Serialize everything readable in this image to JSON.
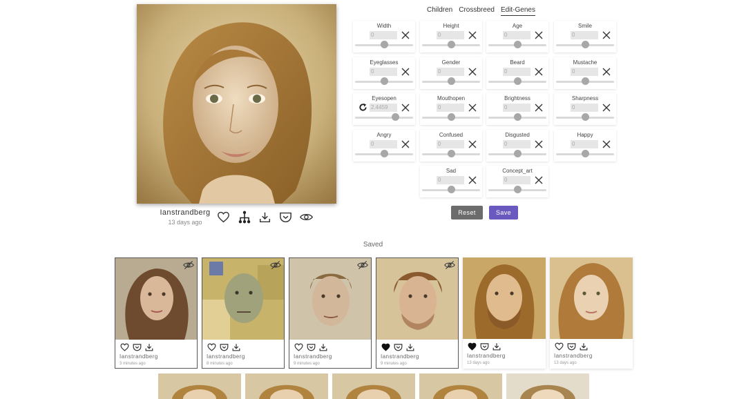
{
  "main": {
    "owner": "Ianstrandberg",
    "time": "13 days ago"
  },
  "tabs": [
    {
      "label": "Children",
      "active": false
    },
    {
      "label": "Crossbreed",
      "active": false
    },
    {
      "label": "Edit-Genes",
      "active": true
    }
  ],
  "genes": [
    {
      "label": "Width",
      "value": "0",
      "level": 0.5
    },
    {
      "label": "Height",
      "value": "0",
      "level": 0.5
    },
    {
      "label": "Age",
      "value": "0",
      "level": 0.5
    },
    {
      "label": "Smile",
      "value": "0",
      "level": 0.5
    },
    {
      "label": "Eyeglasses",
      "value": "0",
      "level": 0.5
    },
    {
      "label": "Gender",
      "value": "0",
      "level": 0.5
    },
    {
      "label": "Beard",
      "value": "0",
      "level": 0.5
    },
    {
      "label": "Mustache",
      "value": "0",
      "level": 0.5
    },
    {
      "label": "Eyesopen",
      "value": "2.4459",
      "level": 0.7
    },
    {
      "label": "Mouthopen",
      "value": "0",
      "level": 0.5
    },
    {
      "label": "Brightness",
      "value": "0",
      "level": 0.5
    },
    {
      "label": "Sharpness",
      "value": "0",
      "level": 0.5
    },
    {
      "label": "Angry",
      "value": "0",
      "level": 0.5
    },
    {
      "label": "Confused",
      "value": "0",
      "level": 0.5
    },
    {
      "label": "Disgusted",
      "value": "0",
      "level": 0.5
    },
    {
      "label": "Happy",
      "value": "0",
      "level": 0.5
    },
    {
      "label": "Sad",
      "value": "0",
      "level": 0.5
    },
    {
      "label": "Concept_art",
      "value": "0",
      "level": 0.5
    }
  ],
  "buttons": {
    "reset": "Reset",
    "save": "Save"
  },
  "saved_title": "Saved",
  "saved": [
    {
      "owner": "Ianstrandberg",
      "time": "3 minutes ago",
      "liked": false,
      "hidden": true
    },
    {
      "owner": "Ianstrandberg",
      "time": "8 minutes ago",
      "liked": false,
      "hidden": true
    },
    {
      "owner": "Ianstrandberg",
      "time": "9 minutes ago",
      "liked": false,
      "hidden": true
    },
    {
      "owner": "Ianstrandberg",
      "time": "9 minutes ago",
      "liked": true,
      "hidden": true
    },
    {
      "owner": "Ianstrandberg",
      "time": "13 days ago",
      "liked": true,
      "hidden": false
    },
    {
      "owner": "Ianstrandberg",
      "time": "13 days ago",
      "liked": false,
      "hidden": false
    }
  ],
  "icons": {
    "like": "heart-icon",
    "crossbreed": "family-tree-icon",
    "download": "download-icon",
    "save": "pocket-icon",
    "visibility": "eye-icon",
    "hidden": "eye-off-icon",
    "clear": "close-icon",
    "reset_gene": "refresh-icon"
  },
  "colors": {
    "save_button": "#6a5ac0",
    "reset_button": "#6c6c6c"
  }
}
